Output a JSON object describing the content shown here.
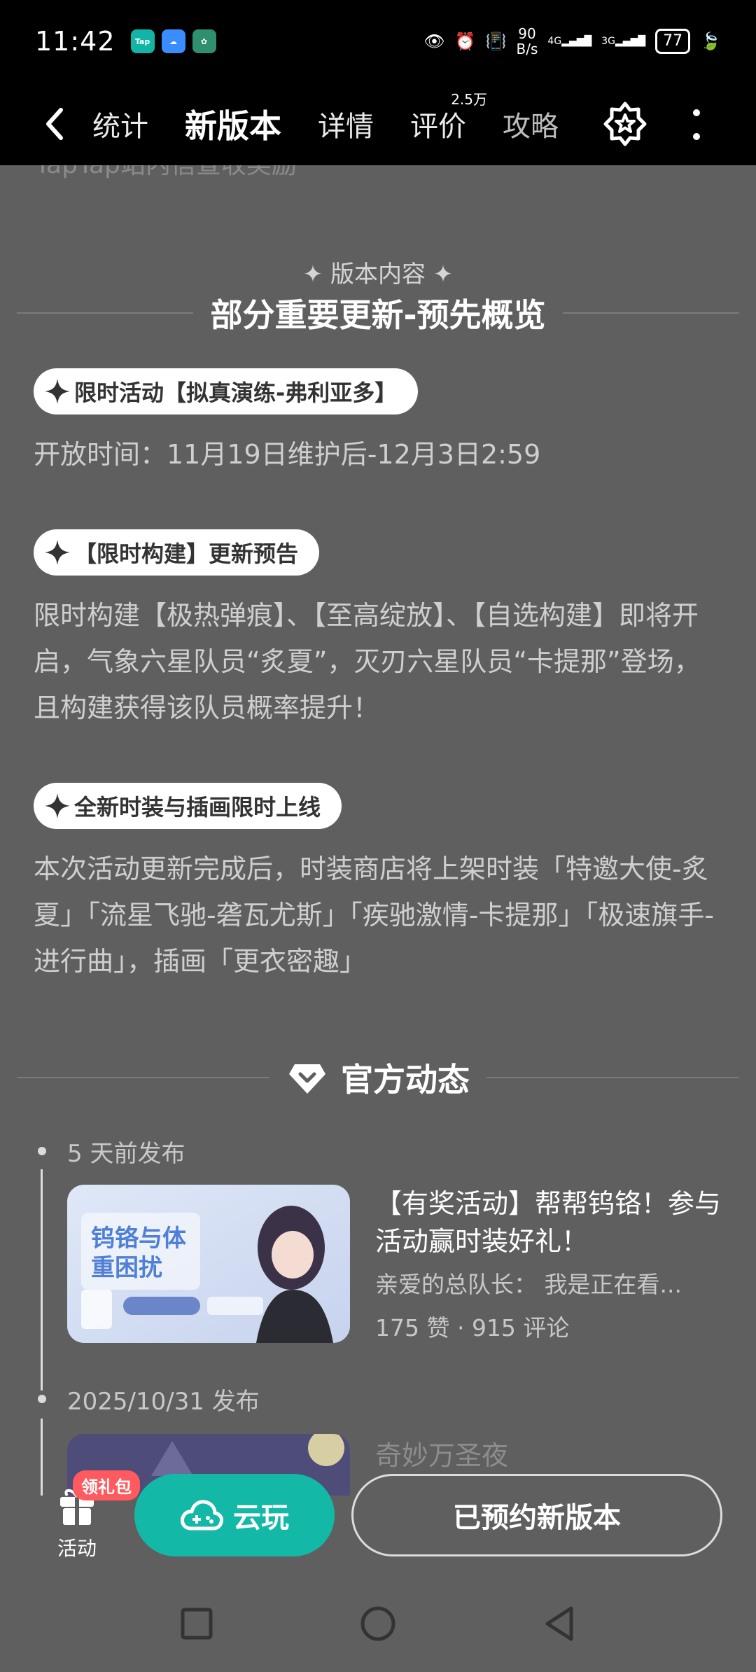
{
  "status_bar": {
    "time": "11:42",
    "apps": [
      "Tap",
      "weather",
      "app"
    ],
    "net_speed": "90",
    "net_speed_unit": "B/s",
    "net1": "4G",
    "net2": "3G",
    "battery": "77"
  },
  "nav": {
    "tabs": [
      {
        "label": "统计",
        "badge": ""
      },
      {
        "label": "新版本",
        "badge": ""
      },
      {
        "label": "详情",
        "badge": ""
      },
      {
        "label": "评价",
        "badge": "2.5万"
      },
      {
        "label": "攻略",
        "badge": ""
      }
    ],
    "active_index": 1
  },
  "cut_text": "TapTap站内信查收奖励",
  "version": {
    "subtitle": "✦ 版本内容 ✦",
    "title": "部分重要更新-预先概览",
    "items": [
      {
        "tag": "限时活动【拟真演练-弗利亚多】",
        "text": "开放时间：11月19日维护后-12月3日2:59"
      },
      {
        "tag": "【限时构建】更新预告",
        "text": "限时构建【极热弹痕】、【至高绽放】、【自选构建】即将开启，气象六星队员“炙夏”，灭刃六星队员“卡提那”登场，且构建获得该队员概率提升！"
      },
      {
        "tag": "全新时装与插画限时上线",
        "text": "本次活动更新完成后，时装商店将上架时装「特邀大使-炙夏」「流星飞驰-砻瓦尤斯」「疾驰激情-卡提那」「极速旗手-进行曲」，插画「更衣密趣」"
      }
    ]
  },
  "official": {
    "title": "官方动态",
    "posts": [
      {
        "date": "5 天前发布",
        "title": "【有奖活动】帮帮钨铬！参与活动赢时装好礼！",
        "excerpt": "亲爱的总队长： 我是正在看...",
        "stats": "175 赞 · 915 评论",
        "thumb_text": "钨铬与体重困扰"
      },
      {
        "date": "2025/10/31 发布",
        "title": "奇妙万圣夜"
      }
    ]
  },
  "action_bar": {
    "gift_badge": "领礼包",
    "gift_label": "活动",
    "cloud_play": "云玩",
    "reserved": "已预约新版本"
  },
  "colors": {
    "accent": "#14c9b0",
    "background": "#5f5f5f",
    "badge": "#ff5a5f"
  }
}
